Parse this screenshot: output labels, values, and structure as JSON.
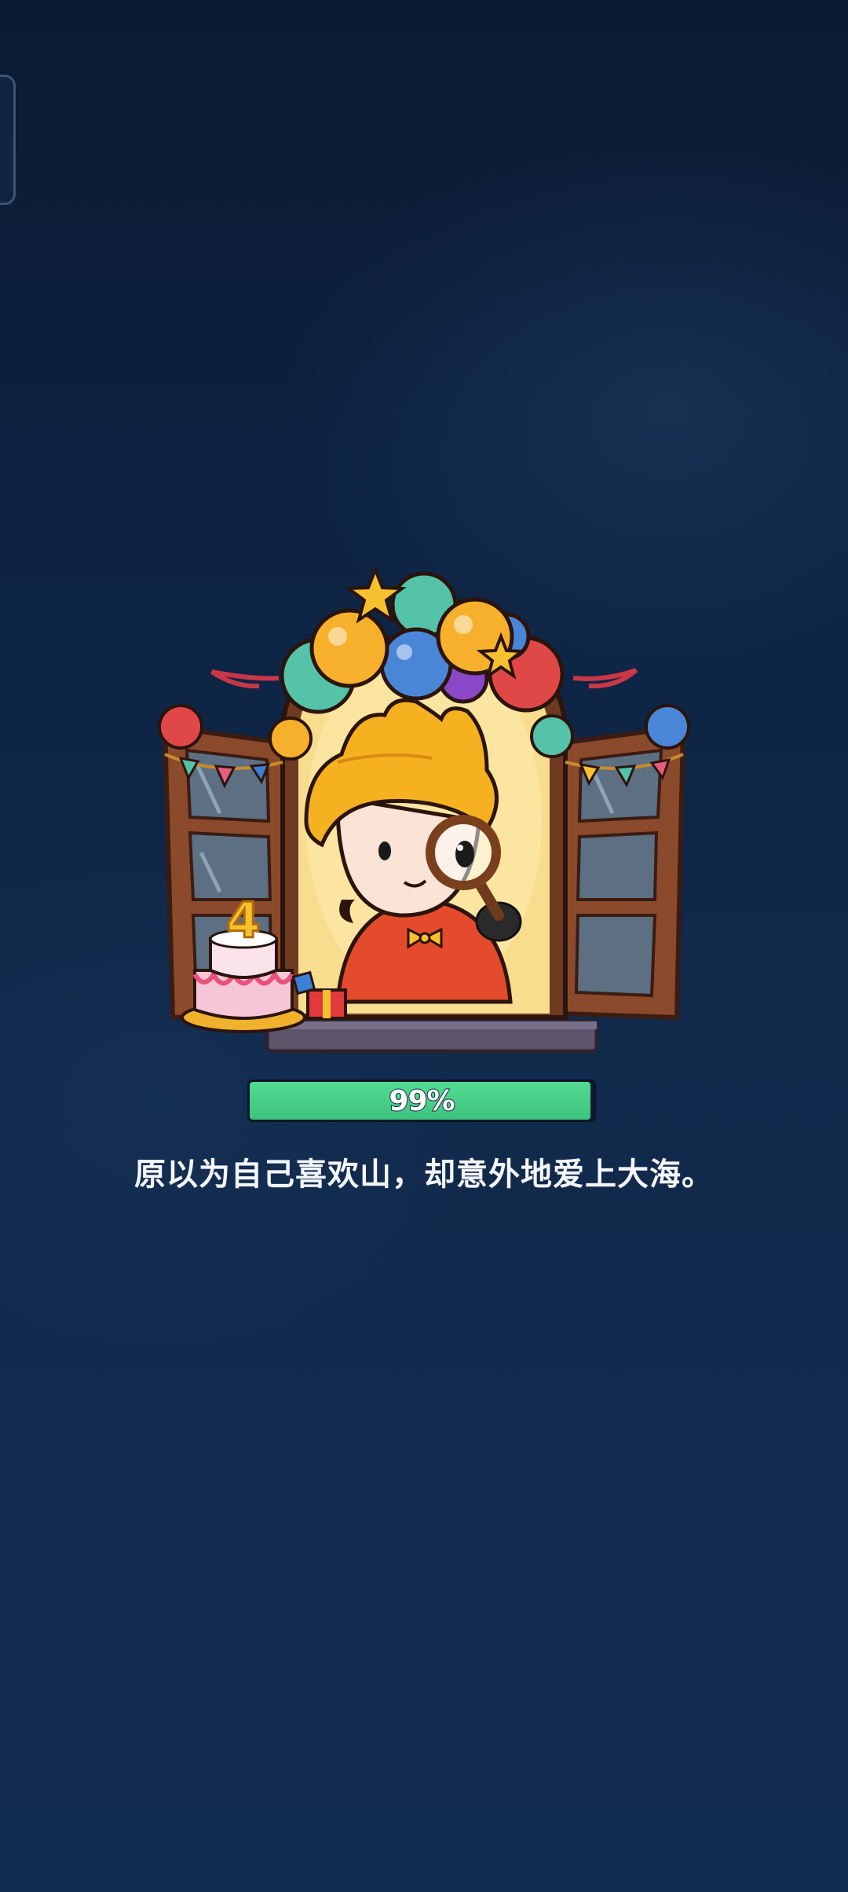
{
  "loading": {
    "progress_percent": 99,
    "progress_label": "99%",
    "tip": "原以为自己喜欢山，却意外地爱上大海。"
  },
  "illustration": {
    "cake_number": "4"
  },
  "colors": {
    "background": "#0d2241",
    "progress_fill": "#45cc86",
    "progress_track": "#0c1e33",
    "text": "#f4f6fa"
  },
  "icons": [
    "side-tab-icon",
    "magnifying-glass-icon",
    "birthday-cake-icon",
    "balloon-icon",
    "star-icon",
    "gift-box-icon"
  ]
}
